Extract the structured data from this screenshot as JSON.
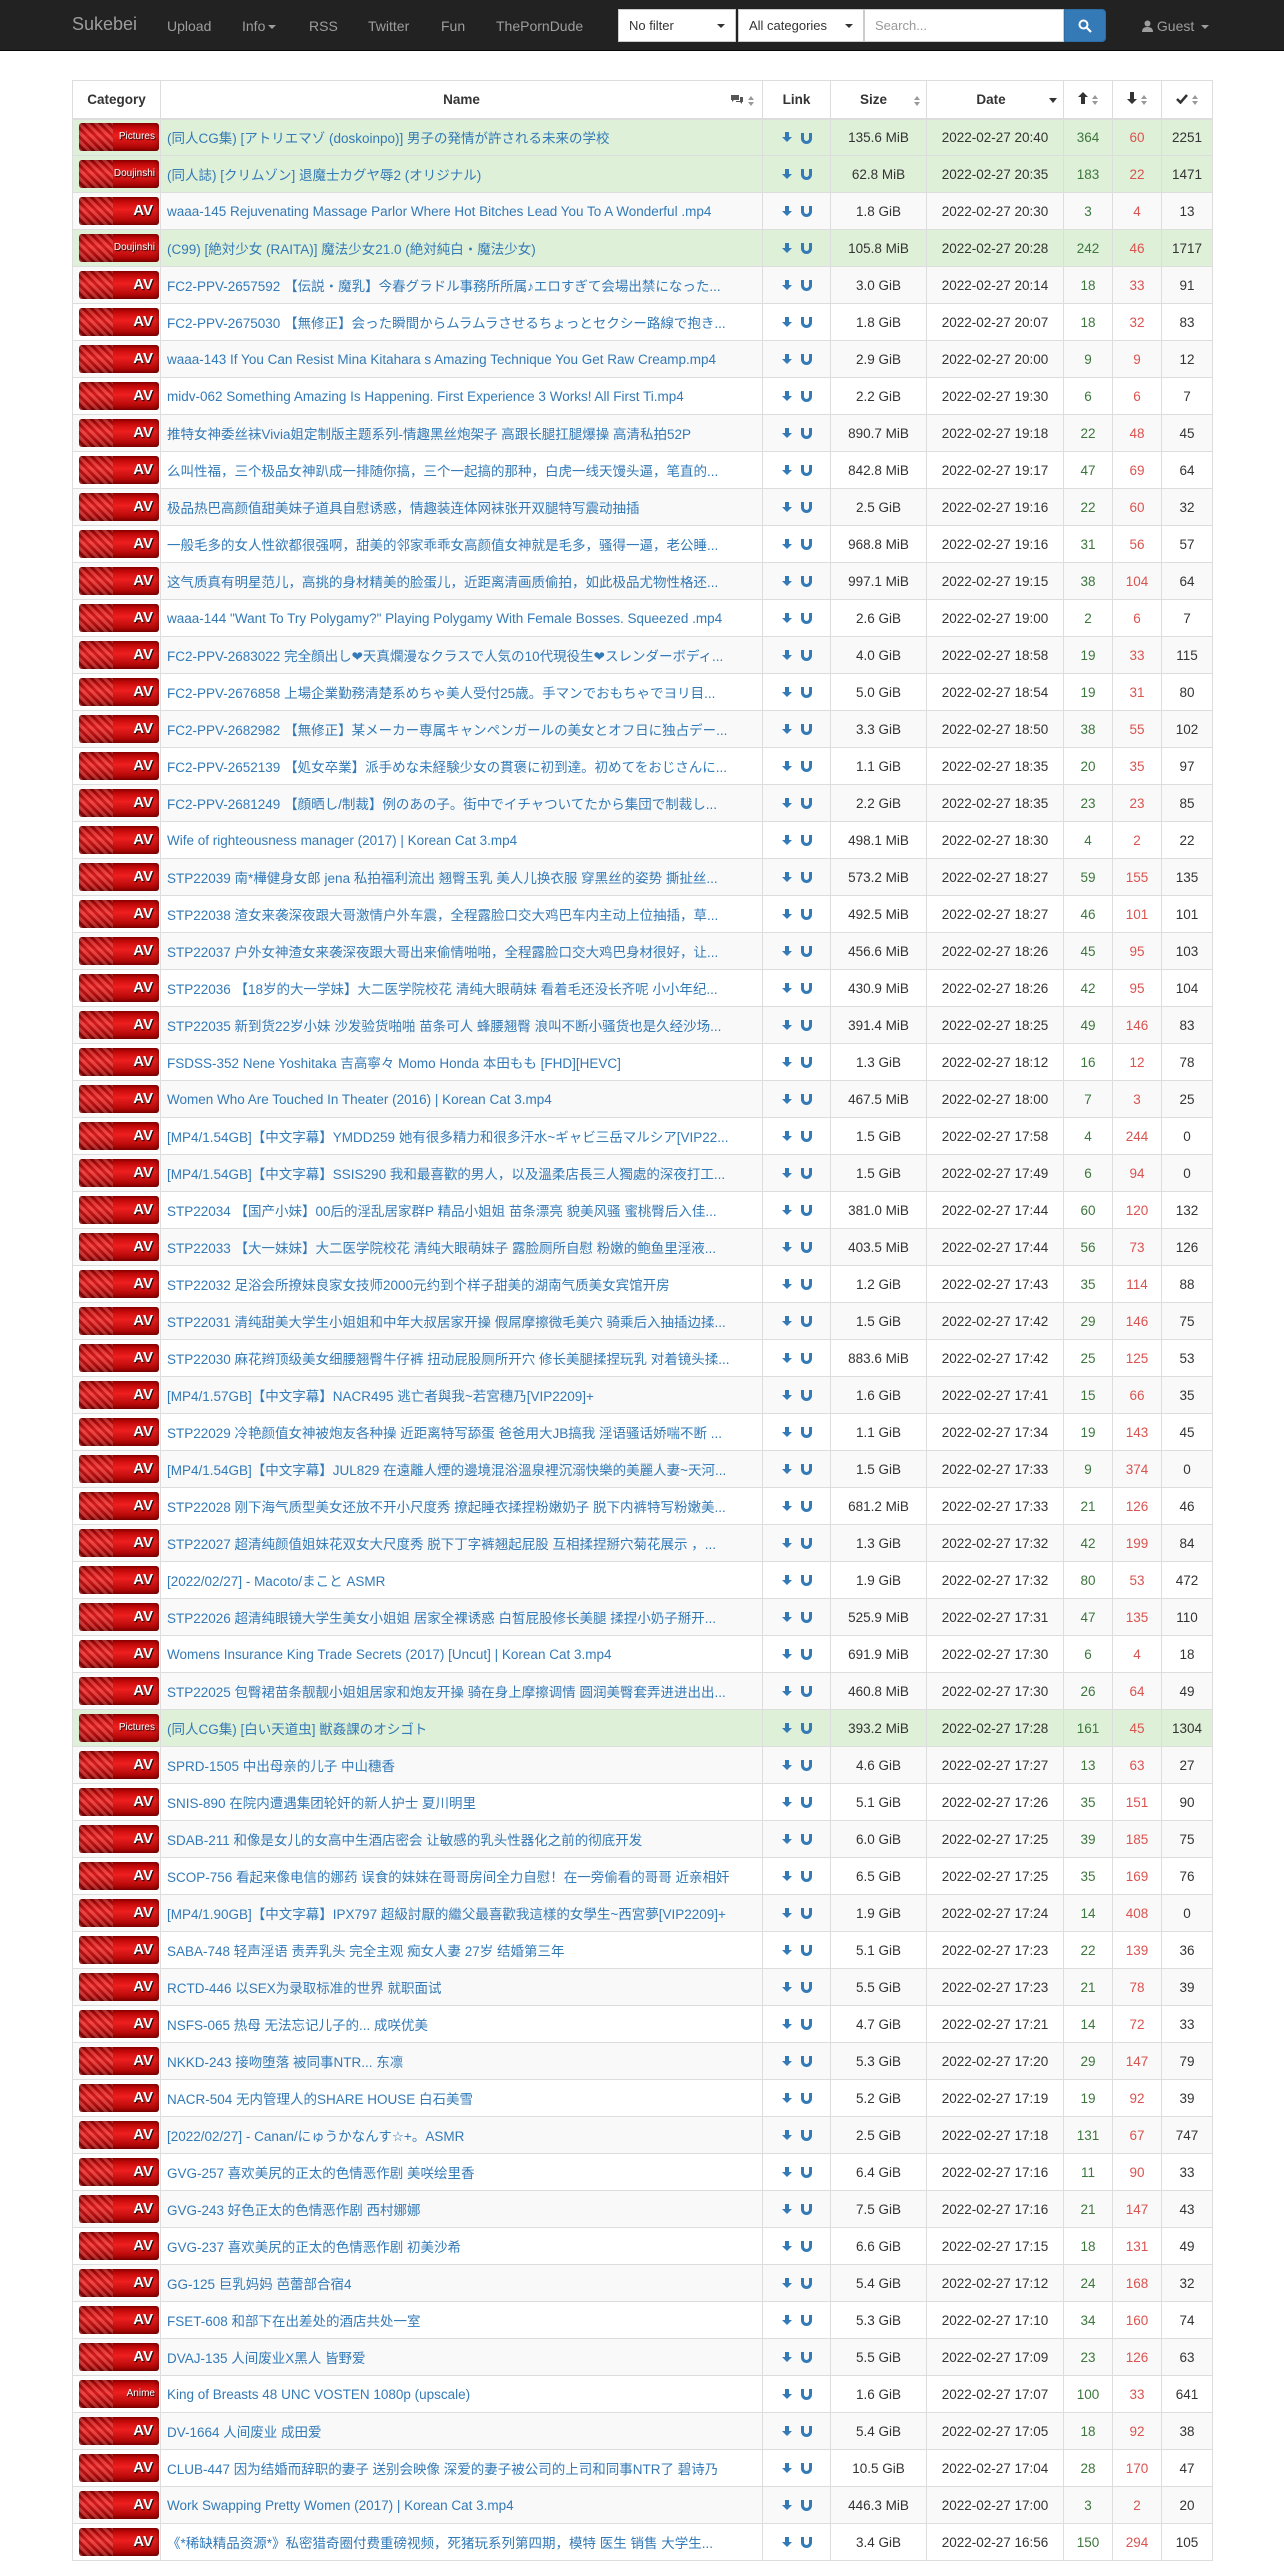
{
  "navbar": {
    "brand": "Sukebei",
    "links": [
      "Upload",
      "Info",
      "RSS",
      "Twitter",
      "Fun",
      "ThePornDude"
    ],
    "filter": "No filter",
    "category": "All categories",
    "search_placeholder": "Search...",
    "user": "Guest"
  },
  "table": {
    "headers": {
      "category": "Category",
      "name": "Name",
      "link": "Link",
      "size": "Size",
      "date": "Date"
    },
    "rows": [
      {
        "cat": "Pictures",
        "name": "(同人CG集) [アトリエマゾ (doskoinpo)] 男子の発情が許される未来の学校",
        "size": "135.6 MiB",
        "date": "2022-02-27 20:40",
        "seed": "364",
        "leech": "60",
        "dl": "2251",
        "hl": true
      },
      {
        "cat": "Doujinshi",
        "name": "(同人誌) [クリムゾン] 退魔士カグヤ辱2 (オリジナル)",
        "size": "62.8 MiB",
        "date": "2022-02-27 20:35",
        "seed": "183",
        "leech": "22",
        "dl": "1471",
        "hl": true
      },
      {
        "cat": "AV",
        "name": "waaa-145 Rejuvenating Massage Parlor Where Hot Bitches Lead You To A Wonderful .mp4",
        "size": "1.8 GiB",
        "date": "2022-02-27 20:30",
        "seed": "3",
        "leech": "4",
        "dl": "13"
      },
      {
        "cat": "Doujinshi",
        "name": "(C99) [絶対少女 (RAITA)] 魔法少女21.0 (絶対純白・魔法少女)",
        "size": "105.8 MiB",
        "date": "2022-02-27 20:28",
        "seed": "242",
        "leech": "46",
        "dl": "1717",
        "hl": true
      },
      {
        "cat": "AV",
        "name": "FC2-PPV-2657592 【伝説・魔乳】今春グラドル事務所所属♪エロすぎて会場出禁になった...",
        "size": "3.0 GiB",
        "date": "2022-02-27 20:14",
        "seed": "18",
        "leech": "33",
        "dl": "91"
      },
      {
        "cat": "AV",
        "name": "FC2-PPV-2675030 【無修正】会った瞬間からムラムラさせるちょっとセクシー路線で抱き...",
        "size": "1.8 GiB",
        "date": "2022-02-27 20:07",
        "seed": "18",
        "leech": "32",
        "dl": "83"
      },
      {
        "cat": "AV",
        "name": "waaa-143 If You Can Resist Mina Kitahara s Amazing Technique You Get Raw Creamp.mp4",
        "size": "2.9 GiB",
        "date": "2022-02-27 20:00",
        "seed": "9",
        "leech": "9",
        "dl": "12"
      },
      {
        "cat": "AV",
        "name": "midv-062 Something Amazing Is Happening. First Experience 3 Works! All First Ti.mp4",
        "size": "2.2 GiB",
        "date": "2022-02-27 19:30",
        "seed": "6",
        "leech": "6",
        "dl": "7"
      },
      {
        "cat": "AV",
        "name": "推特女神委丝袜Vivia姐定制版主题系列-情趣黑丝炮架子 高跟长腿扛腿爆操 高清私拍52P",
        "size": "890.7 MiB",
        "date": "2022-02-27 19:18",
        "seed": "22",
        "leech": "48",
        "dl": "45"
      },
      {
        "cat": "AV",
        "name": "么叫性福，三个极品女神趴成一排随你搞，三个一起搞的那种，白虎一线天馒头逼，笔直的...",
        "size": "842.8 MiB",
        "date": "2022-02-27 19:17",
        "seed": "47",
        "leech": "69",
        "dl": "64"
      },
      {
        "cat": "AV",
        "name": "极品热巴高颜值甜美妹子道具自慰诱惑，情趣装连体网袜张开双腿特写震动抽插",
        "size": "2.5 GiB",
        "date": "2022-02-27 19:16",
        "seed": "22",
        "leech": "60",
        "dl": "32"
      },
      {
        "cat": "AV",
        "name": "一般毛多的女人性欲都很强啊，甜美的邻家乖乖女高颜值女神就是毛多，骚得一逼，老公睡...",
        "size": "968.8 MiB",
        "date": "2022-02-27 19:16",
        "seed": "31",
        "leech": "56",
        "dl": "57"
      },
      {
        "cat": "AV",
        "name": "这气质真有明星范儿，高挑的身材精美的脸蛋儿，近距离清画质偷拍，如此极品尤物性格还...",
        "size": "997.1 MiB",
        "date": "2022-02-27 19:15",
        "seed": "38",
        "leech": "104",
        "dl": "64"
      },
      {
        "cat": "AV",
        "name": "waaa-144 \"Want To Try Polygamy?\" Playing Polygamy With Female Bosses. Squeezed .mp4",
        "size": "2.6 GiB",
        "date": "2022-02-27 19:00",
        "seed": "2",
        "leech": "6",
        "dl": "7"
      },
      {
        "cat": "AV",
        "name": "FC2-PPV-2683022 完全顔出し❤天真爛漫なクラスで人気の10代現役生❤スレンダーボディ...",
        "size": "4.0 GiB",
        "date": "2022-02-27 18:58",
        "seed": "19",
        "leech": "33",
        "dl": "115"
      },
      {
        "cat": "AV",
        "name": "FC2-PPV-2676858 上場企業勤務清楚系めちゃ美人受付25歳。手マンでおもちゃでヨリ目...",
        "size": "5.0 GiB",
        "date": "2022-02-27 18:54",
        "seed": "19",
        "leech": "31",
        "dl": "80"
      },
      {
        "cat": "AV",
        "name": "FC2-PPV-2682982 【無修正】某メーカー専属キャンペンガールの美女とオフ日に独占デー...",
        "size": "3.3 GiB",
        "date": "2022-02-27 18:50",
        "seed": "38",
        "leech": "55",
        "dl": "102"
      },
      {
        "cat": "AV",
        "name": "FC2-PPV-2652139 【処女卒業】派手めな未経験少女の貫褒に初到達。初めてをおじさんに...",
        "size": "1.1 GiB",
        "date": "2022-02-27 18:35",
        "seed": "20",
        "leech": "35",
        "dl": "97"
      },
      {
        "cat": "AV",
        "name": "FC2-PPV-2681249 【顔晒し/制裁】例のあの子。街中でイチャついてたから集団で制裁し...",
        "size": "2.2 GiB",
        "date": "2022-02-27 18:35",
        "seed": "23",
        "leech": "23",
        "dl": "85"
      },
      {
        "cat": "AV",
        "name": "Wife of righteousness manager (2017) | Korean Cat 3.mp4",
        "size": "498.1 MiB",
        "date": "2022-02-27 18:30",
        "seed": "4",
        "leech": "2",
        "dl": "22"
      },
      {
        "cat": "AV",
        "name": "STP22039 南*樺健身女郎 jena 私拍福利流出 翘臀玉乳 美人儿换衣服 穿黑丝的姿势 撕扯丝...",
        "size": "573.2 MiB",
        "date": "2022-02-27 18:27",
        "seed": "59",
        "leech": "155",
        "dl": "135"
      },
      {
        "cat": "AV",
        "name": "STP22038 渣女来袭深夜跟大哥激情户外车震，全程露脸口交大鸡巴车内主动上位抽插，草...",
        "size": "492.5 MiB",
        "date": "2022-02-27 18:27",
        "seed": "46",
        "leech": "101",
        "dl": "101"
      },
      {
        "cat": "AV",
        "name": "STP22037 户外女神渣女来袭深夜跟大哥出来偷情啪啪，全程露脸口交大鸡巴身材很好，让...",
        "size": "456.6 MiB",
        "date": "2022-02-27 18:26",
        "seed": "45",
        "leech": "95",
        "dl": "103"
      },
      {
        "cat": "AV",
        "name": "STP22036 【18岁的大一学妹】大二医学院校花 清纯大眼萌妹 看着毛还没长齐呢 小小年纪...",
        "size": "430.9 MiB",
        "date": "2022-02-27 18:26",
        "seed": "42",
        "leech": "95",
        "dl": "104"
      },
      {
        "cat": "AV",
        "name": "STP22035 新到货22岁小妹 沙发验货啪啪 苗条可人 蜂腰翘臀 浪叫不断小骚货也是久经沙场...",
        "size": "391.4 MiB",
        "date": "2022-02-27 18:25",
        "seed": "49",
        "leech": "146",
        "dl": "83"
      },
      {
        "cat": "AV",
        "name": "FSDSS-352 Nene Yoshitaka 吉高寧々 Momo Honda 本田もも [FHD][HEVC]",
        "size": "1.3 GiB",
        "date": "2022-02-27 18:12",
        "seed": "16",
        "leech": "12",
        "dl": "78"
      },
      {
        "cat": "AV",
        "name": "Women Who Are Touched In Theater (2016) | Korean Cat 3.mp4",
        "size": "467.5 MiB",
        "date": "2022-02-27 18:00",
        "seed": "7",
        "leech": "3",
        "dl": "25"
      },
      {
        "cat": "AV",
        "name": "[MP4/1.54GB]【中文字幕】YMDD259 她有很多精力和很多汗水~ギャビ三岳マルシア[VIP22...",
        "size": "1.5 GiB",
        "date": "2022-02-27 17:58",
        "seed": "4",
        "leech": "244",
        "dl": "0"
      },
      {
        "cat": "AV",
        "name": "[MP4/1.54GB]【中文字幕】SSIS290 我和最喜歡的男人，以及溫柔店長三人獨處的深夜打工...",
        "size": "1.5 GiB",
        "date": "2022-02-27 17:49",
        "seed": "6",
        "leech": "94",
        "dl": "0"
      },
      {
        "cat": "AV",
        "name": "STP22034 【国产小妹】00后的淫乱居家群P 精品小姐姐 苗条漂亮 貌美风骚 蜜桃臀后入佳...",
        "size": "381.0 MiB",
        "date": "2022-02-27 17:44",
        "seed": "60",
        "leech": "120",
        "dl": "132"
      },
      {
        "cat": "AV",
        "name": "STP22033 【大一妹妹】大二医学院校花 清纯大眼萌妹子 露脸厕所自慰 粉嫩的鲍鱼里淫液...",
        "size": "403.5 MiB",
        "date": "2022-02-27 17:44",
        "seed": "56",
        "leech": "73",
        "dl": "126"
      },
      {
        "cat": "AV",
        "name": "STP22032 足浴会所撩妹良家女技师2000元约到个样子甜美的湖南气质美女宾馆开房",
        "size": "1.2 GiB",
        "date": "2022-02-27 17:43",
        "seed": "35",
        "leech": "114",
        "dl": "88"
      },
      {
        "cat": "AV",
        "name": "STP22031 清纯甜美大学生小姐姐和中年大叔居家开操 假屌摩擦微毛美穴 骑乘后入抽插边揉...",
        "size": "1.5 GiB",
        "date": "2022-02-27 17:42",
        "seed": "29",
        "leech": "146",
        "dl": "75"
      },
      {
        "cat": "AV",
        "name": "STP22030 麻花辫顶级美女细腰翘臀牛仔裤 扭动屁股厕所开穴 修长美腿揉捏玩乳 对着镜头揉...",
        "size": "883.6 MiB",
        "date": "2022-02-27 17:42",
        "seed": "25",
        "leech": "125",
        "dl": "53"
      },
      {
        "cat": "AV",
        "name": "[MP4/1.57GB]【中文字幕】NACR495 逃亡者與我~若宮穗乃[VIP2209]+",
        "size": "1.6 GiB",
        "date": "2022-02-27 17:41",
        "seed": "15",
        "leech": "66",
        "dl": "35"
      },
      {
        "cat": "AV",
        "name": "STP22029 冷艳颜值女神被炮友各种操 近距离特写舔蛋 爸爸用大JB搞我 淫语骚话娇喘不断 ...",
        "size": "1.1 GiB",
        "date": "2022-02-27 17:34",
        "seed": "19",
        "leech": "143",
        "dl": "45"
      },
      {
        "cat": "AV",
        "name": "[MP4/1.54GB]【中文字幕】JUL829 在遠離人煙的邊境混浴溫泉裡沉溺快樂的美麗人妻~天河...",
        "size": "1.5 GiB",
        "date": "2022-02-27 17:33",
        "seed": "9",
        "leech": "374",
        "dl": "0"
      },
      {
        "cat": "AV",
        "name": "STP22028 刚下海气质型美女还放不开小尺度秀 撩起睡衣揉捏粉嫩奶子 脱下内裤特写粉嫩美...",
        "size": "681.2 MiB",
        "date": "2022-02-27 17:33",
        "seed": "21",
        "leech": "126",
        "dl": "46"
      },
      {
        "cat": "AV",
        "name": "STP22027 超清纯颜值姐妹花双女大尺度秀 脱下丁字裤翘起屁股 互相揉捏掰穴菊花展示 ，...",
        "size": "1.3 GiB",
        "date": "2022-02-27 17:32",
        "seed": "42",
        "leech": "199",
        "dl": "84"
      },
      {
        "cat": "AV",
        "name": "[2022/02/27] - Macoto/まこと ASMR",
        "size": "1.9 GiB",
        "date": "2022-02-27 17:32",
        "seed": "80",
        "leech": "53",
        "dl": "472"
      },
      {
        "cat": "AV",
        "name": "STP22026 超清纯眼镜大学生美女小姐姐 居家全裸诱惑 白皙屁股修长美腿 揉捏小奶子掰开...",
        "size": "525.9 MiB",
        "date": "2022-02-27 17:31",
        "seed": "47",
        "leech": "135",
        "dl": "110"
      },
      {
        "cat": "AV",
        "name": "Womens Insurance King Trade Secrets (2017) [Uncut] | Korean Cat 3.mp4",
        "size": "691.9 MiB",
        "date": "2022-02-27 17:30",
        "seed": "6",
        "leech": "4",
        "dl": "18"
      },
      {
        "cat": "AV",
        "name": "STP22025 包臀裙苗条靓靓小姐姐居家和炮友开操 骑在身上摩擦调情 圆润美臀套弄进进出出...",
        "size": "460.8 MiB",
        "date": "2022-02-27 17:30",
        "seed": "26",
        "leech": "64",
        "dl": "49"
      },
      {
        "cat": "Pictures",
        "name": "(同人CG集) [白い天道虫] 獣姦課のオシゴト",
        "size": "393.2 MiB",
        "date": "2022-02-27 17:28",
        "seed": "161",
        "leech": "45",
        "dl": "1304",
        "hl": true
      },
      {
        "cat": "AV",
        "name": "SPRD-1505 中出母亲的儿子 中山穗香",
        "size": "4.6 GiB",
        "date": "2022-02-27 17:27",
        "seed": "13",
        "leech": "63",
        "dl": "27"
      },
      {
        "cat": "AV",
        "name": "SNIS-890 在院内遭遇集团轮奸的新人护士 夏川明里",
        "size": "5.1 GiB",
        "date": "2022-02-27 17:26",
        "seed": "35",
        "leech": "151",
        "dl": "90"
      },
      {
        "cat": "AV",
        "name": "SDAB-211 和像是女儿的女高中生酒店密会 让敏感的乳头性器化之前的彻底开发",
        "size": "6.0 GiB",
        "date": "2022-02-27 17:25",
        "seed": "39",
        "leech": "185",
        "dl": "75"
      },
      {
        "cat": "AV",
        "name": "SCOP-756 看起来像电信的娜药 误食的妹妹在哥哥房间全力自慰！在一旁偷看的哥哥 近亲相奸",
        "size": "6.5 GiB",
        "date": "2022-02-27 17:25",
        "seed": "35",
        "leech": "169",
        "dl": "76"
      },
      {
        "cat": "AV",
        "name": "[MP4/1.90GB]【中文字幕】IPX797 超級討厭的繼父最喜歡我這樣的女學生~西宮夢[VIP2209]+",
        "size": "1.9 GiB",
        "date": "2022-02-27 17:24",
        "seed": "14",
        "leech": "408",
        "dl": "0"
      },
      {
        "cat": "AV",
        "name": "SABA-748 轻声淫语 责弄乳头 完全主观 痴女人妻 27岁 结婚第三年",
        "size": "5.1 GiB",
        "date": "2022-02-27 17:23",
        "seed": "22",
        "leech": "139",
        "dl": "36"
      },
      {
        "cat": "AV",
        "name": "RCTD-446 以SEX为录取标准的世界 就职面试",
        "size": "5.5 GiB",
        "date": "2022-02-27 17:23",
        "seed": "21",
        "leech": "78",
        "dl": "39"
      },
      {
        "cat": "AV",
        "name": "NSFS-065 热母 无法忘记儿子的... 成咲优美",
        "size": "4.7 GiB",
        "date": "2022-02-27 17:21",
        "seed": "14",
        "leech": "72",
        "dl": "33"
      },
      {
        "cat": "AV",
        "name": "NKKD-243 接吻堕落 被同事NTR... 东凛",
        "size": "5.3 GiB",
        "date": "2022-02-27 17:20",
        "seed": "29",
        "leech": "147",
        "dl": "79"
      },
      {
        "cat": "AV",
        "name": "NACR-504 无内管理人的SHARE HOUSE 白石美雪",
        "size": "5.2 GiB",
        "date": "2022-02-27 17:19",
        "seed": "19",
        "leech": "92",
        "dl": "39"
      },
      {
        "cat": "AV",
        "name": "[2022/02/27] - Canan/にゅうかなんす☆+。ASMR",
        "size": "2.5 GiB",
        "date": "2022-02-27 17:18",
        "seed": "131",
        "leech": "67",
        "dl": "747"
      },
      {
        "cat": "AV",
        "name": "GVG-257 喜欢美尻的正太的色情恶作剧 美咲绘里香",
        "size": "6.4 GiB",
        "date": "2022-02-27 17:16",
        "seed": "11",
        "leech": "90",
        "dl": "33"
      },
      {
        "cat": "AV",
        "name": "GVG-243 好色正太的色情恶作剧 西村娜娜",
        "size": "7.5 GiB",
        "date": "2022-02-27 17:16",
        "seed": "21",
        "leech": "147",
        "dl": "43"
      },
      {
        "cat": "AV",
        "name": "GVG-237 喜欢美尻的正太的色情恶作剧 初美沙希",
        "size": "6.6 GiB",
        "date": "2022-02-27 17:15",
        "seed": "18",
        "leech": "131",
        "dl": "49"
      },
      {
        "cat": "AV",
        "name": "GG-125 巨乳妈妈 芭蕾部合宿4",
        "size": "5.4 GiB",
        "date": "2022-02-27 17:12",
        "seed": "24",
        "leech": "168",
        "dl": "32"
      },
      {
        "cat": "AV",
        "name": "FSET-608 和部下在出差处的酒店共处一室",
        "size": "5.3 GiB",
        "date": "2022-02-27 17:10",
        "seed": "34",
        "leech": "160",
        "dl": "74"
      },
      {
        "cat": "AV",
        "name": "DVAJ-135 人间废业X黑人 皆野爱",
        "size": "5.5 GiB",
        "date": "2022-02-27 17:09",
        "seed": "23",
        "leech": "126",
        "dl": "63"
      },
      {
        "cat": "Anime",
        "name": "King of Breasts 48 UNC VOSTEN 1080p (upscale)",
        "size": "1.6 GiB",
        "date": "2022-02-27 17:07",
        "seed": "100",
        "leech": "33",
        "dl": "641"
      },
      {
        "cat": "AV",
        "name": "DV-1664 人间废业 成田爱",
        "size": "5.4 GiB",
        "date": "2022-02-27 17:05",
        "seed": "18",
        "leech": "92",
        "dl": "38"
      },
      {
        "cat": "AV",
        "name": "CLUB-447 因为结婚而辞职的妻子 送别会映像 深爱的妻子被公司的上司和同事NTR了 碧诗乃",
        "size": "10.5 GiB",
        "date": "2022-02-27 17:04",
        "seed": "28",
        "leech": "170",
        "dl": "47"
      },
      {
        "cat": "AV",
        "name": "Work Swapping Pretty Women (2017) | Korean Cat 3.mp4",
        "size": "446.3 MiB",
        "date": "2022-02-27 17:00",
        "seed": "3",
        "leech": "2",
        "dl": "20"
      },
      {
        "cat": "AV",
        "name": "《*稀缺精品资源*》私密猎奇圈付费重磅视频，死猪玩系列第四期，模特 医生 销售 大学生...",
        "size": "3.4 GiB",
        "date": "2022-02-27 16:56",
        "seed": "150",
        "leech": "294",
        "dl": "105"
      }
    ]
  }
}
